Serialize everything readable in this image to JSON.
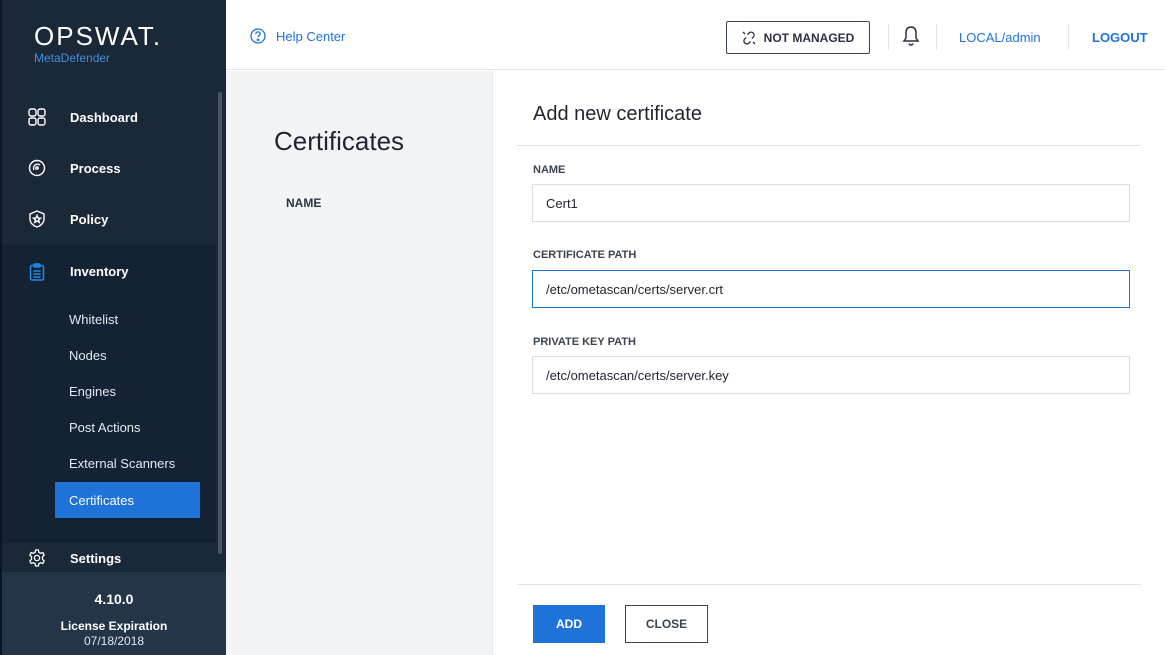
{
  "brand": {
    "name": "OPSWAT.",
    "product": "MetaDefender"
  },
  "nav": {
    "dashboard": "Dashboard",
    "process": "Process",
    "policy": "Policy",
    "inventory": "Inventory",
    "inventory_items": [
      "Whitelist",
      "Nodes",
      "Engines",
      "Post Actions",
      "External Scanners",
      "Certificates"
    ],
    "active_item": "Certificates",
    "settings": "Settings"
  },
  "footer": {
    "version": "4.10.0",
    "license_label": "License Expiration",
    "license_date": "07/18/2018"
  },
  "topbar": {
    "help": "Help Center",
    "managed_status": "NOT MANAGED",
    "user": "LOCAL/admin",
    "logout": "LOGOUT"
  },
  "content": {
    "title": "Certificates",
    "column_name": "NAME"
  },
  "panel": {
    "title": "Add new certificate",
    "name_label": "NAME",
    "name_value": "Cert1",
    "cert_label": "CERTIFICATE PATH",
    "cert_value": "/etc/ometascan/certs/server.crt",
    "key_label": "PRIVATE KEY PATH",
    "key_value": "/etc/ometascan/certs/server.key",
    "add": "ADD",
    "close": "CLOSE"
  },
  "colors": {
    "accent": "#1f72d8",
    "sidebar": "#1b2838",
    "sidebar_sub": "#152234"
  }
}
